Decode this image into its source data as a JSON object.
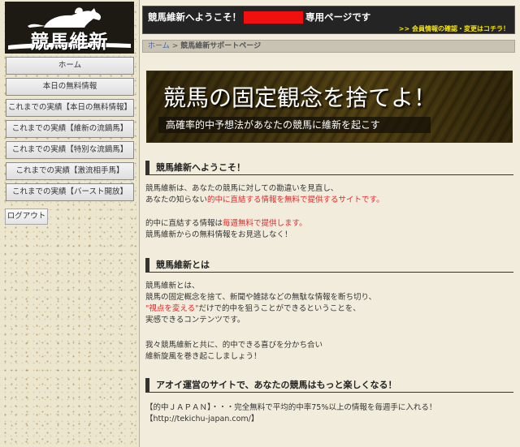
{
  "sidebar": {
    "logo_text": "競馬維新",
    "nav": [
      {
        "label": "ホーム"
      },
      {
        "label": "本日の無料情報"
      },
      {
        "label": "これまでの実績【本日の無料情報】"
      },
      {
        "label": "これまでの実績【維新の流鏑馬】"
      },
      {
        "label": "これまでの実績【特別な流鏑馬】"
      },
      {
        "label": "これまでの実績【激流相手馬】"
      },
      {
        "label": "これまでの実績【バースト開放】"
      }
    ],
    "logout_label": "ログアウト"
  },
  "header": {
    "title_prefix": "競馬維新へようこそ！",
    "title_suffix": "専用ページです",
    "member_link": ">> 会員情報の確認・変更はコチラ！"
  },
  "breadcrumb": {
    "home": "ホーム",
    "separator": ">",
    "current": "競馬維新サポートページ"
  },
  "banner": {
    "title": "競馬の固定観念を捨てよ！",
    "subtitle": "高確率的中予想法があなたの競馬に維新を起こす"
  },
  "sections": {
    "welcome": {
      "heading": "競馬維新へようこそ！",
      "l1": "競馬維新は、あなたの競馬に対しての勘違いを見直し、",
      "l2a": "あなたの知らない",
      "l2b": "的中に直結する情報を無料で提供するサイトです。",
      "l3a": "的中に直結する情報は",
      "l3b": "毎週無料で提供します。",
      "l4": "競馬維新からの無料情報をお見逃しなく！"
    },
    "about": {
      "heading": "競馬維新とは",
      "l1": "競馬維新とは、",
      "l2": "競馬の固定概念を捨て、新聞や雑誌などの無駄な情報を断ち切り、",
      "l3a": "\"視点を変える\"",
      "l3b": "だけで的中を狙うことができるということを、",
      "l4": "実感できるコンテンツです。",
      "l5": "我々競馬維新と共に、的中できる喜びを分かち合い",
      "l6": "維新旋風を巻き起こしましょう！"
    },
    "affiliate": {
      "heading": "アオイ運営のサイトで、あなたの競馬はもっと楽しくなる！",
      "l1": "【的中ＪＡＰＡＮ】・・・完全無料で平均的中率75%以上の情報を毎週手に入れる！",
      "l2": "【http://tekichu-japan.com/】"
    }
  },
  "colors": {
    "header_bg": "#242424",
    "accent_yellow": "#f5e313",
    "highlight_red": "#e8262a",
    "link_blue": "#4a63a8"
  }
}
